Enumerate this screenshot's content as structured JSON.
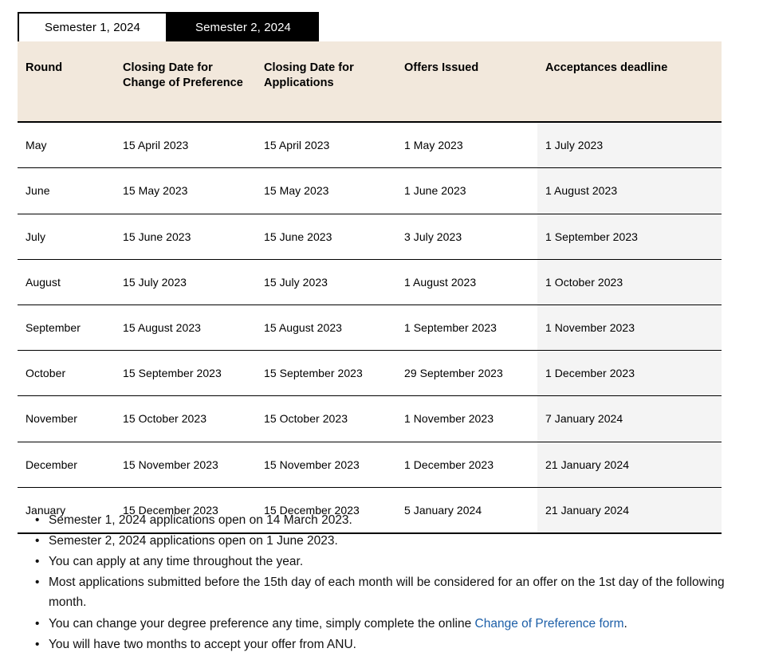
{
  "tabs": [
    {
      "label": "Semester 1, 2024",
      "active": false
    },
    {
      "label": "Semester 2, 2024",
      "active": true
    }
  ],
  "table": {
    "columns": [
      "Round",
      "Closing Date for Change of Preference",
      "Closing Date for Applications",
      "Offers Issued",
      "Acceptances deadline"
    ],
    "rows": [
      {
        "round": "May",
        "closing_change_of_preference": "15 April 2023",
        "closing_applications": "15 April 2023",
        "offers_issued": "1 May 2023",
        "acceptances_deadline": "1 July 2023"
      },
      {
        "round": "June",
        "closing_change_of_preference": "15 May 2023",
        "closing_applications": "15 May 2023",
        "offers_issued": "1 June 2023",
        "acceptances_deadline": "1 August 2023"
      },
      {
        "round": "July",
        "closing_change_of_preference": "15 June 2023",
        "closing_applications": "15 June 2023",
        "offers_issued": "3 July 2023",
        "acceptances_deadline": "1 September 2023"
      },
      {
        "round": "August",
        "closing_change_of_preference": "15 July 2023",
        "closing_applications": "15 July 2023",
        "offers_issued": "1 August 2023",
        "acceptances_deadline": "1 October 2023"
      },
      {
        "round": "September",
        "closing_change_of_preference": "15 August 2023",
        "closing_applications": "15 August 2023",
        "offers_issued": "1 September 2023",
        "acceptances_deadline": "1 November 2023"
      },
      {
        "round": "October",
        "closing_change_of_preference": "15 September 2023",
        "closing_applications": "15 September 2023",
        "offers_issued": "29 September 2023",
        "acceptances_deadline": "1 December 2023"
      },
      {
        "round": "November",
        "closing_change_of_preference": "15 October 2023",
        "closing_applications": "15 October 2023",
        "offers_issued": "1 November 2023",
        "acceptances_deadline": "7 January 2024"
      },
      {
        "round": "December",
        "closing_change_of_preference": "15 November 2023",
        "closing_applications": "15 November 2023",
        "offers_issued": "1 December 2023",
        "acceptances_deadline": "21 January 2024"
      },
      {
        "round": "January",
        "closing_change_of_preference": "15 December 2023",
        "closing_applications": "15 December 2023",
        "offers_issued": "5 January 2024",
        "acceptances_deadline": "21 January 2024"
      }
    ]
  },
  "notes": {
    "bullet_glyph": "•",
    "items": [
      {
        "text": "Semester 1, 2024 applications open on 14 March 2023."
      },
      {
        "text": "Semester 2, 2024 applications open on 1 June 2023."
      },
      {
        "text": "You can apply at any time throughout the year."
      },
      {
        "text": "Most applications submitted before the 15th day of each month will be considered for an offer on the 1st day of the following month."
      },
      {
        "text_before": "You can change your degree preference any time, simply complete the online ",
        "link_text": "Change of Preference form",
        "text_after": "."
      },
      {
        "text": "You will have two months to accept your offer from ANU."
      }
    ]
  },
  "colors": {
    "header_band": "#f2e8dc",
    "shaded_column": "#f4f4f4",
    "active_tab_bg": "#000000",
    "link": "#1d5fa8"
  }
}
